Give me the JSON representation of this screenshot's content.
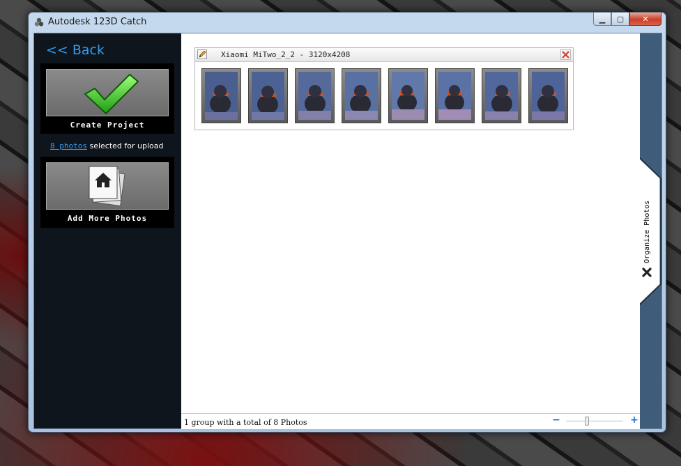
{
  "window": {
    "title": "Autodesk 123D Catch",
    "buttons": {
      "minimize": "▁",
      "maximize": "▢",
      "close": "✕"
    }
  },
  "left_panel": {
    "back_label": "<< Back",
    "create_project_label": "Create Project",
    "upload_info": {
      "link": "8 photos",
      "suffix": " selected for upload"
    },
    "add_photos_label": "Add More Photos",
    "icons": [
      "checkmark-icon",
      "photo-stack-icon"
    ]
  },
  "group": {
    "title": "Xiaomi MiTwo_2_2 - 3120x4208",
    "photo_count": 8,
    "icons": [
      "pencil-icon",
      "close-icon"
    ]
  },
  "statusbar": {
    "text": "1 group with a total of 8 Photos",
    "zoom_minus": "−",
    "zoom_plus": "+",
    "zoom_level": 0.35
  },
  "right_panel": {
    "tab_label": "Organize Photos",
    "icon": "close-icon"
  },
  "colors": {
    "accent": "#2f9df4",
    "panel_bg": "#0f151c",
    "check_green": "#3fcf2f"
  }
}
